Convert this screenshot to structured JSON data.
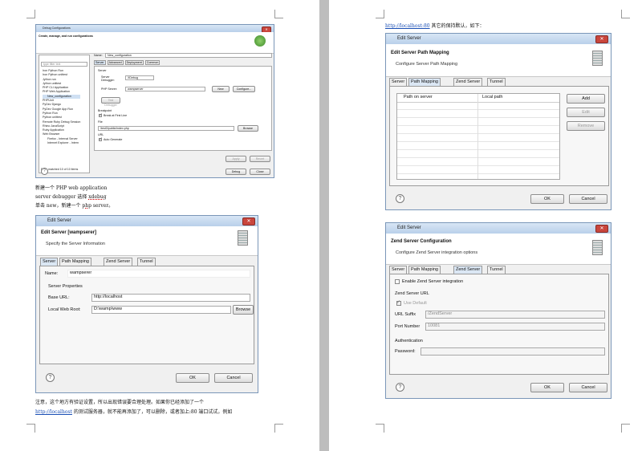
{
  "left_page": {
    "debug_dialog": {
      "title": "Debug Configurations",
      "header_title": "Create, manage, and run configurations",
      "filter_placeholder": "type filter text",
      "tree_items": [
        "New_launch_configuration",
        "Iron Python Run",
        "Iron Python unittest",
        "Jython run",
        "Jython unittest",
        "PHP CLI Application",
        "PHP Web Application",
        "New_configuration",
        "PHPUnit",
        "PyDev Django",
        "PyDev Google App Run",
        "Python Run",
        "Python unittest",
        "Remote Ruby Debug Session",
        "Rhino JavaScript",
        "Ruby Application",
        "Web Browser",
        "Firefox - Internal Server",
        "Internet Explorer - Intern"
      ],
      "filter_status": "Filter matched 10 of 10 items",
      "name_label": "Name:",
      "name_value": "New_configuration",
      "tabs": [
        "Server",
        "Advanced",
        "Deployment",
        "Common"
      ],
      "server_group": "Server",
      "server_debugger_label": "Server Debugger:",
      "server_debugger_value": "XDebug",
      "php_server_label": "PHP Server:",
      "php_server_value": "wampserver",
      "new_label": "New",
      "configure_label": "Configure...",
      "test_debugger_label": "Test Debugger",
      "breakpoint_group": "Breakpoint",
      "break_first_line": "Break at First Line",
      "file_group": "File",
      "file_value": "/test3/public/index.php",
      "browse_label": "Browse",
      "url_group": "URL",
      "auto_generate": "Auto Generate",
      "apply_label": "Apply",
      "revert_label": "Revert",
      "debug_label": "Debug",
      "close_label": "Close"
    },
    "text_line1": "新建一个 PHP web application",
    "text_line2a": "server debugger 选择 ",
    "text_line2b": "xdebug",
    "text_line3a": "单击 new，新建一个 ",
    "text_line3b": "php",
    "text_line3c": " server。",
    "edit_server": {
      "title": "Edit Server",
      "header_title": "Edit Server [wampserer]",
      "header_sub": "Specify the Server Information",
      "tabs": [
        "Server",
        "Path Mapping",
        "Zend Server",
        "Tunnel"
      ],
      "name_label": "Name:",
      "name_value": "wampserer",
      "props_label": "Server Properties",
      "base_url_label": "Base URL:",
      "base_url_value": "http://localhost",
      "root_label": "Local Web Root:",
      "root_value": "D:\\wamp\\www",
      "browse_label": "Browse",
      "ok_label": "OK",
      "cancel_label": "Cancel"
    },
    "bottom_line1": "注意，这个地方有验证设置，所以出现错误要合理处理。如果你已经添加了一个",
    "bottom_line2a": "http://localhost",
    "bottom_line2b": " 的测试服务器，就不能再添加了，可以删除，或者加上:80 端口试试，例如"
  },
  "right_page": {
    "top_link": "http://localhost:80",
    "top_text": " 其它的保持默认，如下：",
    "path_dialog": {
      "title": "Edit Server",
      "header_title": "Edit Server Path Mapping",
      "header_sub": "Configure Server Path Mapping",
      "tabs": [
        "Server",
        "Path Mapping",
        "Zend Server",
        "Tunnel"
      ],
      "col_server": "Path on server",
      "col_local": "Local path",
      "add_label": "Add",
      "edit_label": "Edit",
      "remove_label": "Remove",
      "ok_label": "OK",
      "cancel_label": "Cancel"
    },
    "zend_dialog": {
      "title": "Edit Server",
      "header_title": "Zend Server Configuration",
      "header_sub": "Configure Zend Server integration options",
      "tabs": [
        "Server",
        "Path Mapping",
        "Zend Server",
        "Tunnel"
      ],
      "enable_label": "Enable Zend Server integration",
      "url_group": "Zend Server URL",
      "use_default": "Use Default",
      "url_suffix_label": "URL Suffix",
      "url_suffix_value": "/ZendServer",
      "port_label": "Port Number",
      "port_value": "10081",
      "auth_label": "Authentication",
      "password_label": "Password:",
      "ok_label": "OK",
      "cancel_label": "Cancel"
    }
  }
}
